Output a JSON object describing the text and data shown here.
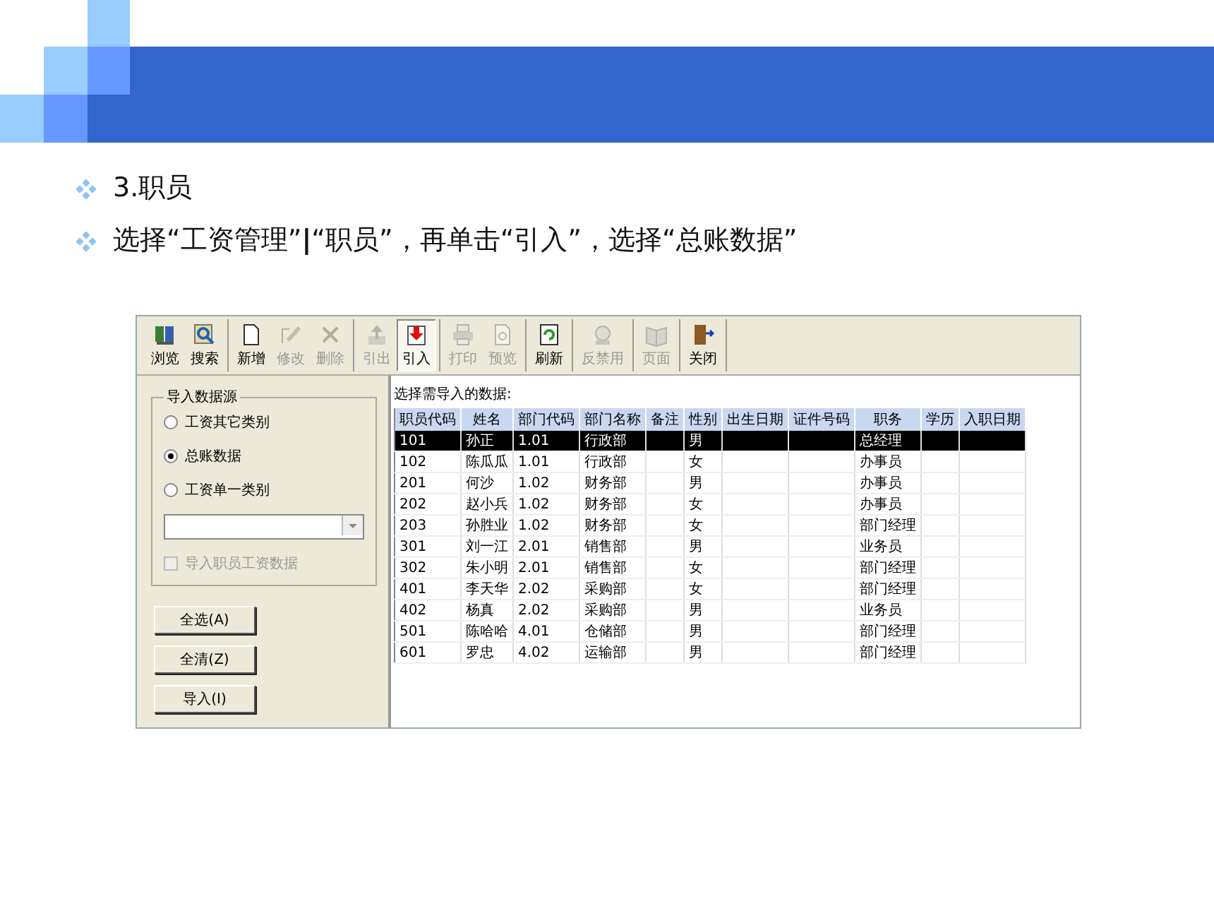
{
  "bullets": [
    {
      "text": "3.职员"
    },
    {
      "text": "选择“工资管理”**|**“职员”，再单击“引入”，选择“总账数据”"
    }
  ],
  "toolbar": {
    "groups": [
      {
        "items": [
          {
            "label": "浏览",
            "disabled": false,
            "pressed": false
          },
          {
            "label": "搜索",
            "disabled": false,
            "pressed": false
          }
        ]
      },
      {
        "items": [
          {
            "label": "新增",
            "disabled": false,
            "pressed": false
          },
          {
            "label": "修改",
            "disabled": true,
            "pressed": false
          },
          {
            "label": "删除",
            "disabled": true,
            "pressed": false
          }
        ]
      },
      {
        "items": [
          {
            "label": "引出",
            "disabled": true,
            "pressed": false
          },
          {
            "label": "引入",
            "disabled": false,
            "pressed": true
          }
        ]
      },
      {
        "items": [
          {
            "label": "打印",
            "disabled": true,
            "pressed": false
          },
          {
            "label": "预览",
            "disabled": true,
            "pressed": false
          }
        ]
      },
      {
        "items": [
          {
            "label": "刷新",
            "disabled": false,
            "pressed": false
          }
        ]
      },
      {
        "items": [
          {
            "label": "反禁用",
            "disabled": true,
            "pressed": false
          }
        ]
      },
      {
        "items": [
          {
            "label": "页面",
            "disabled": true,
            "pressed": false
          }
        ]
      },
      {
        "items": [
          {
            "label": "关闭",
            "disabled": false,
            "pressed": false
          }
        ]
      }
    ]
  },
  "import_source": {
    "title": "导入数据源",
    "options": [
      {
        "label": "工资其它类别",
        "selected": false
      },
      {
        "label": "总账数据",
        "selected": true
      },
      {
        "label": "工资单一类别",
        "selected": false
      }
    ],
    "checkbox": {
      "label": "导入职员工资数据",
      "checked": false,
      "disabled": true
    },
    "buttons": [
      "全选(A)",
      "全清(Z)",
      "导入(I)"
    ]
  },
  "table": {
    "caption": "选择需导入的数据:",
    "columns": [
      "职员代码",
      "姓名",
      "部门代码",
      "部门名称",
      "备注",
      "性别",
      "出生日期",
      "证件号码",
      "职务",
      "学历",
      "入职日期"
    ],
    "rows": [
      {
        "selected": true,
        "cells": [
          "101",
          "孙正",
          "1.01",
          "行政部",
          null,
          "男",
          null,
          null,
          "总经理",
          null,
          null
        ]
      },
      {
        "selected": false,
        "cells": [
          "102",
          "陈瓜瓜",
          "1.01",
          "行政部",
          null,
          "女",
          null,
          null,
          "办事员",
          null,
          null
        ]
      },
      {
        "selected": false,
        "cells": [
          "201",
          "何沙",
          "1.02",
          "财务部",
          null,
          "男",
          null,
          null,
          "办事员",
          null,
          null
        ]
      },
      {
        "selected": false,
        "cells": [
          "202",
          "赵小兵",
          "1.02",
          "财务部",
          null,
          "女",
          null,
          null,
          "办事员",
          null,
          null
        ]
      },
      {
        "selected": false,
        "cells": [
          "203",
          "孙胜业",
          "1.02",
          "财务部",
          null,
          "女",
          null,
          null,
          "部门经理",
          null,
          null
        ]
      },
      {
        "selected": false,
        "cells": [
          "301",
          "刘一江",
          "2.01",
          "销售部",
          null,
          "男",
          null,
          null,
          "业务员",
          null,
          null
        ]
      },
      {
        "selected": false,
        "cells": [
          "302",
          "朱小明",
          "2.01",
          "销售部",
          null,
          "女",
          null,
          null,
          "部门经理",
          null,
          null
        ]
      },
      {
        "selected": false,
        "cells": [
          "401",
          "李天华",
          "2.02",
          "采购部",
          null,
          "女",
          null,
          null,
          "部门经理",
          null,
          null
        ]
      },
      {
        "selected": false,
        "cells": [
          "402",
          "杨真",
          "2.02",
          "采购部",
          null,
          "男",
          null,
          null,
          "业务员",
          null,
          null
        ]
      },
      {
        "selected": false,
        "cells": [
          "501",
          "陈哈哈",
          "4.01",
          "仓储部",
          null,
          "男",
          null,
          null,
          "部门经理",
          null,
          null
        ]
      },
      {
        "selected": false,
        "cells": [
          "601",
          "罗忠",
          "4.02",
          "运输部",
          null,
          "男",
          null,
          null,
          "部门经理",
          null,
          null
        ]
      }
    ]
  }
}
